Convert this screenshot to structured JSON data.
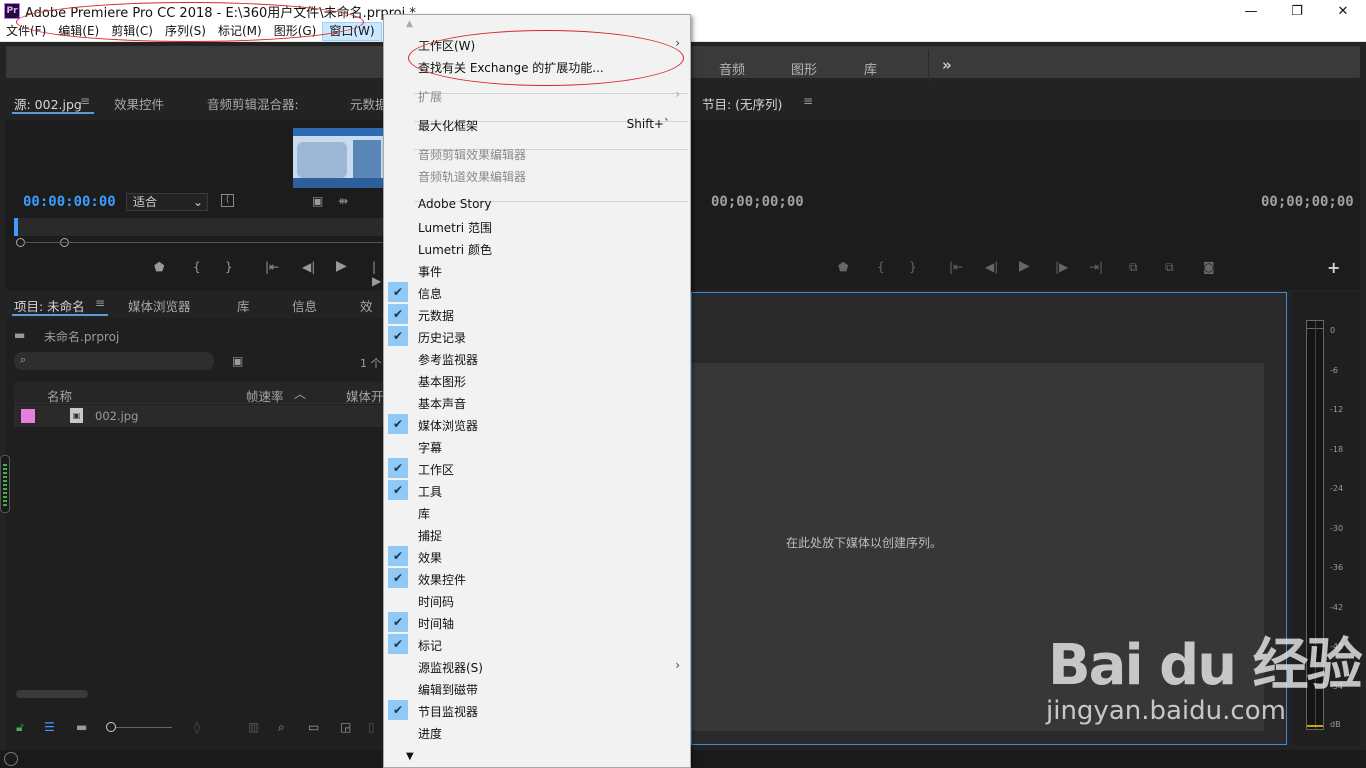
{
  "window": {
    "title": "Adobe Premiere Pro CC 2018 - E:\\360用户文件\\未命名.prproj *",
    "logo_text": "Pr",
    "minimize": "—",
    "maximize": "❐",
    "close": "✕"
  },
  "menubar": {
    "items": [
      "文件(F)",
      "编辑(E)",
      "剪辑(C)",
      "序列(S)",
      "标记(M)",
      "图形(G)",
      "窗口(W)"
    ]
  },
  "workspace": {
    "tabs": [
      "音频",
      "图形",
      "库"
    ],
    "more": "»"
  },
  "source_panel": {
    "tabs": [
      "源: 002.jpg",
      "效果控件",
      "音频剪辑混合器:",
      "元数据"
    ],
    "timecode": "00:00:00:00",
    "fit_select": "适合"
  },
  "program_panel": {
    "tab": "节目: (无序列)",
    "timecode_left": "00;00;00;00",
    "timecode_right": "00;00;00;00",
    "drop_hint": "在此处放下媒体以创建序列。"
  },
  "project_panel": {
    "tabs": [
      "项目: 未命名",
      "媒体浏览器",
      "库",
      "信息",
      "效"
    ],
    "file_name": "未命名.prproj",
    "item_count": "1 个",
    "columns": [
      "名称",
      "帧速率",
      "媒体开"
    ],
    "rows": [
      {
        "name": "002.jpg",
        "color": "#e87fe0"
      }
    ]
  },
  "audio_meter": {
    "scale": [
      "0",
      "-6",
      "-12",
      "-18",
      "-24",
      "-30",
      "-36",
      "-42",
      "-48",
      "-54",
      "dB"
    ]
  },
  "context_menu": {
    "items": [
      {
        "label": "工作区(W)",
        "submenu": true,
        "enabled": true,
        "checked": false
      },
      {
        "label": "查找有关 Exchange 的扩展功能...",
        "enabled": true,
        "checked": false
      },
      {
        "label": "扩展",
        "submenu": true,
        "enabled": false,
        "checked": false
      },
      {
        "label": "最大化框架",
        "shortcut": "Shift+`",
        "enabled": true,
        "checked": false
      },
      {
        "label": "音频剪辑效果编辑器",
        "enabled": false,
        "checked": false
      },
      {
        "label": "音频轨道效果编辑器",
        "enabled": false,
        "checked": false
      },
      {
        "label": "Adobe Story",
        "enabled": true,
        "checked": false
      },
      {
        "label": "Lumetri 范围",
        "enabled": true,
        "checked": false
      },
      {
        "label": "Lumetri 颜色",
        "enabled": true,
        "checked": false
      },
      {
        "label": "事件",
        "enabled": true,
        "checked": false
      },
      {
        "label": "信息",
        "enabled": true,
        "checked": true
      },
      {
        "label": "元数据",
        "enabled": true,
        "checked": true
      },
      {
        "label": "历史记录",
        "enabled": true,
        "checked": true
      },
      {
        "label": "参考监视器",
        "enabled": true,
        "checked": false
      },
      {
        "label": "基本图形",
        "enabled": true,
        "checked": false
      },
      {
        "label": "基本声音",
        "enabled": true,
        "checked": false
      },
      {
        "label": "媒体浏览器",
        "enabled": true,
        "checked": true
      },
      {
        "label": "字幕",
        "enabled": true,
        "checked": false
      },
      {
        "label": "工作区",
        "enabled": true,
        "checked": true
      },
      {
        "label": "工具",
        "enabled": true,
        "checked": true
      },
      {
        "label": "库",
        "enabled": true,
        "checked": false
      },
      {
        "label": "捕捉",
        "enabled": true,
        "checked": false
      },
      {
        "label": "效果",
        "enabled": true,
        "checked": true
      },
      {
        "label": "效果控件",
        "enabled": true,
        "checked": true
      },
      {
        "label": "时间码",
        "enabled": true,
        "checked": false
      },
      {
        "label": "时间轴",
        "enabled": true,
        "checked": true
      },
      {
        "label": "标记",
        "enabled": true,
        "checked": true
      },
      {
        "label": "源监视器(S)",
        "submenu": true,
        "enabled": true,
        "checked": false
      },
      {
        "label": "编辑到磁带",
        "enabled": true,
        "checked": false
      },
      {
        "label": "节目监视器",
        "enabled": true,
        "checked": true
      },
      {
        "label": "进度",
        "enabled": true,
        "checked": false
      }
    ],
    "check_glyph": "✔",
    "arrow_glyph": "›",
    "scroll_up": "▲",
    "scroll_down": "▼"
  },
  "watermark": {
    "logo": "Bai du 经验",
    "url": "jingyan.baidu.com"
  }
}
